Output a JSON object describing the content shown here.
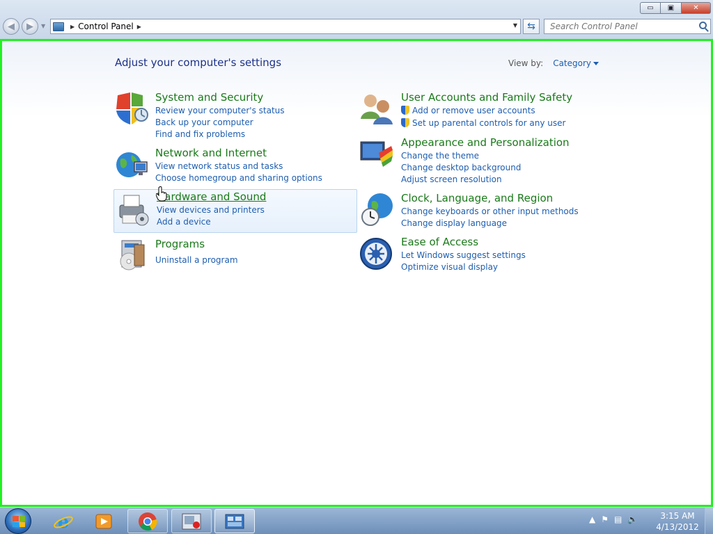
{
  "window": {
    "minimize_glyph": "▭",
    "maximize_glyph": "▣",
    "close_glyph": "✕"
  },
  "address_bar": {
    "path": [
      "Control Panel"
    ],
    "search_placeholder": "Search Control Panel"
  },
  "content": {
    "heading": "Adjust your computer's settings",
    "view_by_label": "View by:",
    "view_by_value": "Category",
    "categories": [
      {
        "title": "System and Security",
        "icon": "shield-icon",
        "links": [
          "Review your computer's status",
          "Back up your computer",
          "Find and fix problems"
        ]
      },
      {
        "title": "Network and Internet",
        "icon": "network-globe-icon",
        "links": [
          "View network status and tasks",
          "Choose homegroup and sharing options"
        ]
      },
      {
        "title": "Hardware and Sound",
        "icon": "printer-icon",
        "links": [
          "View devices and printers",
          "Add a device"
        ]
      },
      {
        "title": "Programs",
        "icon": "programs-icon",
        "links": [
          "Uninstall a program"
        ]
      },
      {
        "title": "User Accounts and Family Safety",
        "icon": "users-icon",
        "links": [
          "Add or remove user accounts",
          "Set up parental controls for any user"
        ]
      },
      {
        "title": "Appearance and Personalization",
        "icon": "monitor-paint-icon",
        "links": [
          "Change the theme",
          "Change desktop background",
          "Adjust screen resolution"
        ]
      },
      {
        "title": "Clock, Language, and Region",
        "icon": "clock-globe-icon",
        "links": [
          "Change keyboards or other input methods",
          "Change display language"
        ]
      },
      {
        "title": "Ease of Access",
        "icon": "ease-of-access-icon",
        "links": [
          "Let Windows suggest settings",
          "Optimize visual display"
        ]
      }
    ]
  },
  "taskbar": {
    "pinned": [
      "internet-explorer-icon",
      "media-player-icon",
      "chrome-icon",
      "recorder-icon",
      "control-panel-icon"
    ],
    "clock_time": "3:15 AM",
    "clock_date": "4/13/2012"
  }
}
